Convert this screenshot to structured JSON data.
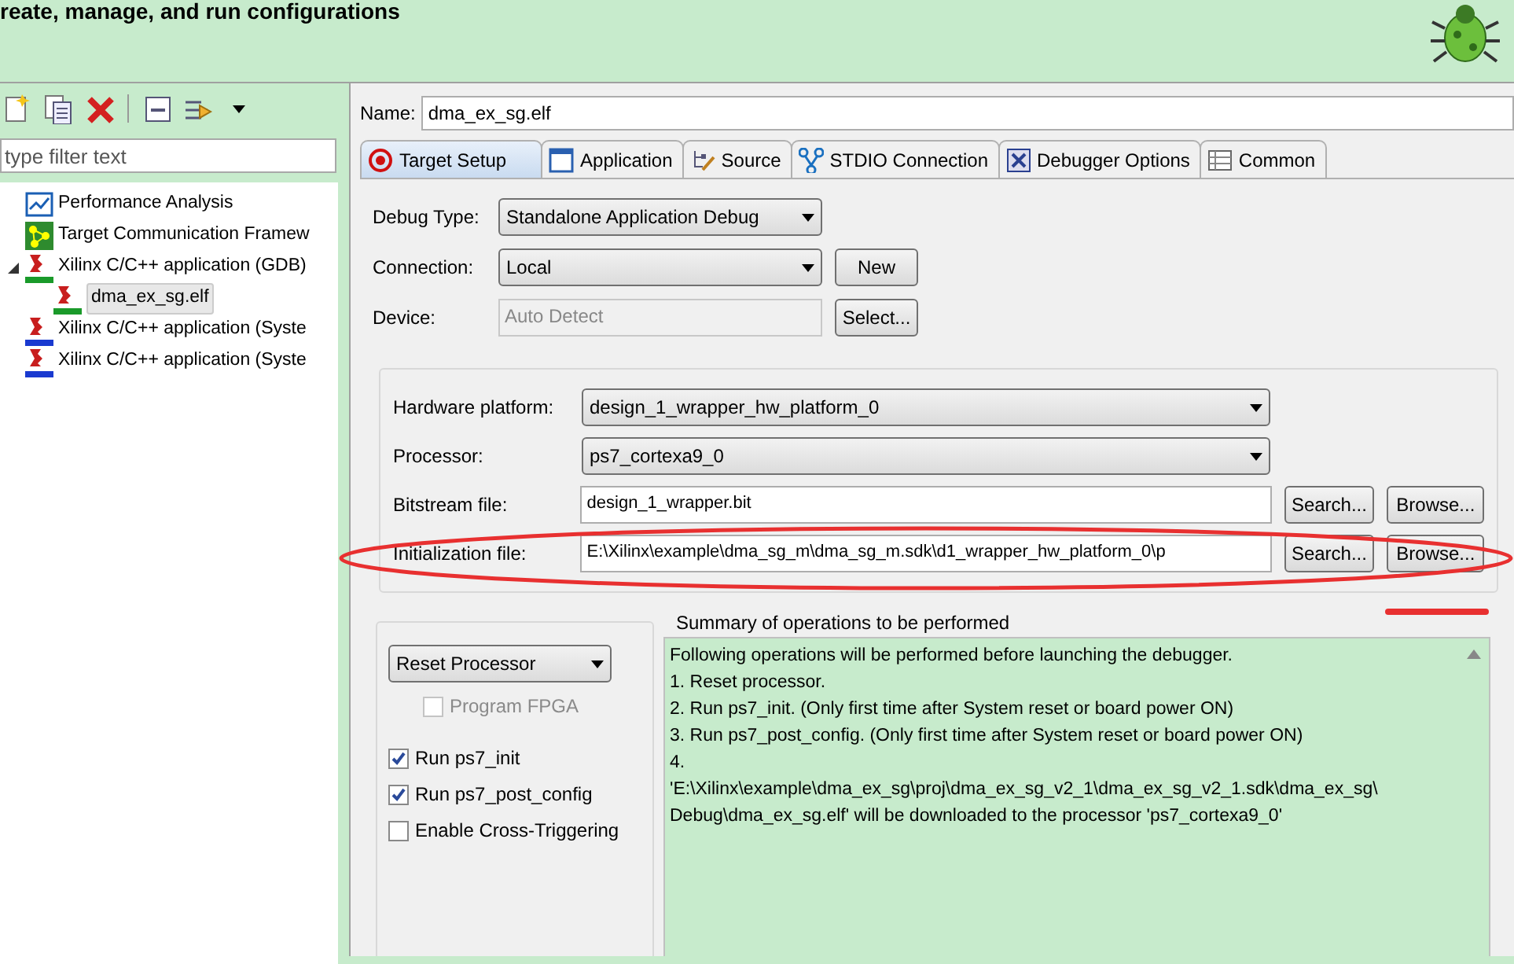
{
  "header": {
    "title": "reate, manage, and run configurations"
  },
  "toolbar": {
    "buttons": [
      {
        "kind": "new"
      },
      {
        "kind": "duplicate"
      },
      {
        "kind": "delete"
      },
      {
        "kind": "collapse"
      },
      {
        "kind": "filter"
      },
      {
        "kind": "menu"
      }
    ]
  },
  "filter": {
    "placeholder": "type filter text"
  },
  "tree": [
    {
      "label": "Performance Analysis",
      "kind": "chart",
      "selected": false
    },
    {
      "label": "Target Communication Framew",
      "kind": "tcf",
      "selected": false
    },
    {
      "label": "Xilinx C/C++ application (GDB)",
      "kind": "gdb",
      "selected": false,
      "expanded": true,
      "children": [
        {
          "label": "dma_ex_sg.elf",
          "kind": "gdb",
          "selected": true
        }
      ]
    },
    {
      "label": "Xilinx C/C++ application (Syste",
      "kind": "xtcf",
      "selected": false
    },
    {
      "label": "Xilinx C/C++ application (Syste",
      "kind": "xtcf",
      "selected": false
    }
  ],
  "name_field": {
    "label": "Name:",
    "value": "dma_ex_sg.elf"
  },
  "tabs": [
    {
      "label": "Target Setup",
      "kind": "target",
      "selected": true
    },
    {
      "label": "Application",
      "kind": "window",
      "selected": false
    },
    {
      "label": "Source",
      "kind": "source",
      "selected": false
    },
    {
      "label": "STDIO Connection",
      "kind": "stdio",
      "selected": false
    },
    {
      "label": "Debugger Options",
      "kind": "debugger",
      "selected": false
    },
    {
      "label": "Common",
      "kind": "common",
      "selected": false
    }
  ],
  "target_rows": [
    {
      "label": "Debug Type:",
      "kind": "select",
      "value": "Standalone Application Debug"
    },
    {
      "label": "Connection:",
      "kind": "select",
      "value": "Local",
      "button": "New"
    },
    {
      "label": "Device:",
      "kind": "disabled",
      "value": "Auto Detect",
      "button": "Select..."
    }
  ],
  "hardware_rows": [
    {
      "label": "Hardware platform:",
      "kind": "select",
      "value": "design_1_wrapper_hw_platform_0"
    },
    {
      "label": "Processor:",
      "kind": "select",
      "value": "ps7_cortexa9_0"
    },
    {
      "label": "Bitstream file:",
      "kind": "file",
      "value": "design_1_wrapper.bit",
      "buttons": [
        "Search...",
        "Browse..."
      ]
    },
    {
      "label": "Initialization file:",
      "kind": "file",
      "value": "E:\\Xilinx\\example\\dma_sg_m\\dma_sg_m.sdk\\d1_wrapper_hw_platform_0\\p",
      "buttons": [
        "Search...",
        "Browse..."
      ]
    }
  ],
  "reset_select": {
    "value": "Reset Processor"
  },
  "options": [
    {
      "label": "Program FPGA",
      "checked": false,
      "disabled": true
    },
    {
      "label": "Run ps7_init",
      "checked": true,
      "disabled": false
    },
    {
      "label": "Run ps7_post_config",
      "checked": true,
      "disabled": false
    },
    {
      "label": "Enable Cross-Triggering",
      "checked": false,
      "disabled": false
    }
  ],
  "summary": {
    "title": "Summary of operations to be performed",
    "lines": [
      "Following operations will be performed before launching the debugger.",
      "1. Reset processor.",
      "2. Run ps7_init. (Only first time after System reset or board power ON)",
      "3. Run ps7_post_config. (Only first time after System reset or board power ON)",
      "4.",
      "'E:\\Xilinx\\example\\dma_ex_sg\\proj\\dma_ex_sg_v2_1\\dma_ex_sg_v2_1.sdk\\dma_ex_sg\\",
      "Debug\\dma_ex_sg.elf' will be downloaded to the processor 'ps7_cortexa9_0'"
    ]
  }
}
